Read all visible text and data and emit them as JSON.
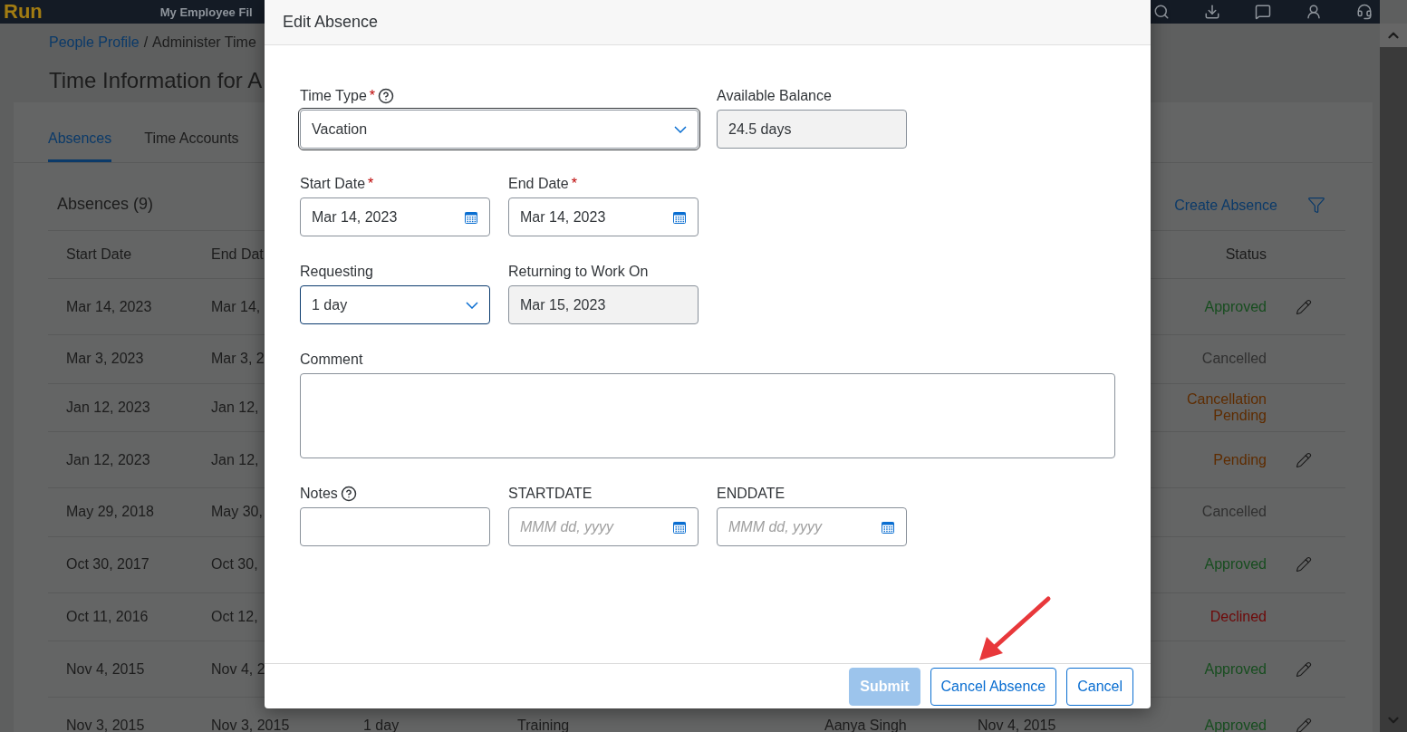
{
  "top_bar": {
    "logo": "Run",
    "app_title": "My Employee Fil"
  },
  "breadcrumb": {
    "link": "People Profile",
    "separator": "/",
    "current": "Administer Time"
  },
  "page_title": "Time Information for A",
  "tabs": [
    {
      "label": "Absences",
      "selected": true
    },
    {
      "label": "Time Accounts",
      "selected": false
    }
  ],
  "absences": {
    "title": "Absences (9)",
    "create_link": "Create Absence",
    "columns": {
      "start_date": "Start Date",
      "end_date": "End Dat",
      "status": "Status"
    },
    "rows": [
      {
        "start_date": "Mar 14, 2023",
        "end_date": "Mar 14,",
        "status": "Approved",
        "color": "#174d1f",
        "editable": true
      },
      {
        "start_date": "Mar 3, 2023",
        "end_date": "Mar 3, 2",
        "status": "Cancelled",
        "color": "#303030",
        "editable": false
      },
      {
        "start_date": "Jan 12, 2023",
        "end_date": "Jan 12,",
        "status": "Cancellation Pending",
        "color": "#5e2c00",
        "editable": false
      },
      {
        "start_date": "Jan 12, 2023",
        "end_date": "Jan 12,",
        "status": "Pending",
        "color": "#5e2c00",
        "editable": true
      },
      {
        "start_date": "May 29, 2018",
        "end_date": "May 30,",
        "status": "Cancelled",
        "color": "#303030",
        "editable": false
      },
      {
        "start_date": "Oct 30, 2017",
        "end_date": "Oct 30,",
        "status": "Approved",
        "color": "#174d1f",
        "editable": true
      },
      {
        "start_date": "Oct 11, 2016",
        "end_date": "Oct 12,",
        "status": "Declined",
        "color": "#6e0808",
        "editable": false
      },
      {
        "start_date": "Nov 4, 2015",
        "end_date": "Nov 4, 2",
        "status": "Approved",
        "color": "#174d1f",
        "editable": true
      },
      {
        "start_date": "Nov 3, 2015",
        "end_date": "Nov 3, 2015",
        "column_3": "1 day",
        "column_4": "Training",
        "column_5": "Aanya Singh",
        "column_6": "Nov 4, 2015",
        "status": "Approved",
        "color": "#174d1f",
        "editable": true
      }
    ]
  },
  "dialog": {
    "title": "Edit Absence",
    "form_rows": [
      [
        {
          "label": "Time Type",
          "required_mark": "*",
          "help": true,
          "kind": "select",
          "value": "Vacation",
          "focused": true
        },
        {
          "label": "Available Balance",
          "help": false,
          "kind": "readonly",
          "value": "24.5 days"
        }
      ],
      [
        {
          "label": "Start Date",
          "required_mark": "*",
          "help": false,
          "kind": "date",
          "value": "Mar 14, 2023"
        },
        {
          "label": "End Date",
          "required_mark": "*",
          "help": false,
          "kind": "date",
          "value": "Mar 14, 2023"
        }
      ],
      [
        {
          "label": "Requesting",
          "help": false,
          "kind": "select",
          "value": "1 day",
          "focused": false
        },
        {
          "label": "Returning to Work On",
          "help": false,
          "kind": "readonly",
          "value": "Mar 15, 2023"
        }
      ],
      [
        {
          "label": "Comment",
          "help": false,
          "kind": "textarea"
        }
      ],
      [
        {
          "label": "Notes",
          "help": true,
          "kind": "text"
        },
        {
          "label": "STARTDATE",
          "help": false,
          "kind": "date",
          "placeholder": "MMM dd, yyyy"
        },
        {
          "label": "ENDDATE",
          "help": false,
          "kind": "date",
          "placeholder": "MMM dd, yyyy"
        }
      ]
    ],
    "buttons": [
      {
        "label": "Submit",
        "kind": "emphasized",
        "disabled": true
      },
      {
        "label": "Cancel Absence",
        "kind": "outline",
        "disabled": false
      },
      {
        "label": "Cancel",
        "kind": "outline",
        "disabled": false
      }
    ]
  }
}
